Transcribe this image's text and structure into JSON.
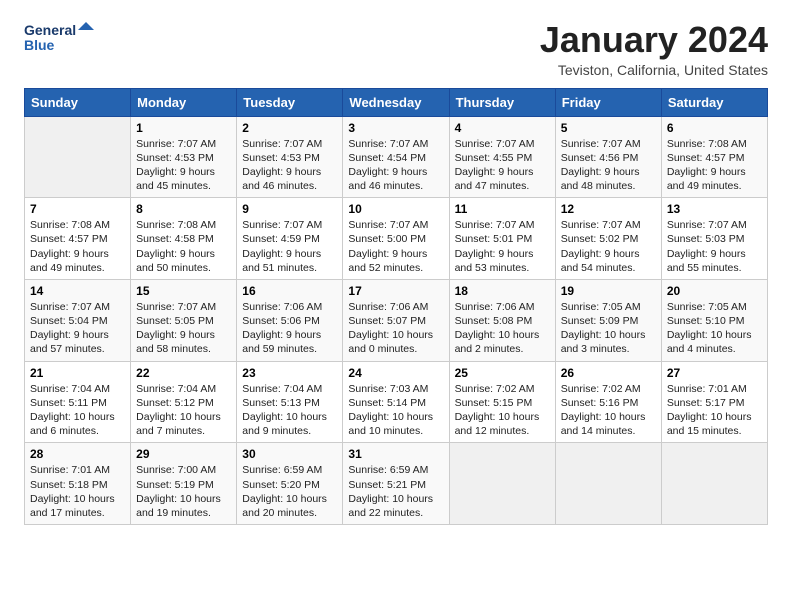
{
  "logo": {
    "line1": "General",
    "line2": "Blue"
  },
  "title": "January 2024",
  "location": "Teviston, California, United States",
  "days_of_week": [
    "Sunday",
    "Monday",
    "Tuesday",
    "Wednesday",
    "Thursday",
    "Friday",
    "Saturday"
  ],
  "weeks": [
    [
      {
        "num": "",
        "info": ""
      },
      {
        "num": "1",
        "info": "Sunrise: 7:07 AM\nSunset: 4:53 PM\nDaylight: 9 hours\nand 45 minutes."
      },
      {
        "num": "2",
        "info": "Sunrise: 7:07 AM\nSunset: 4:53 PM\nDaylight: 9 hours\nand 46 minutes."
      },
      {
        "num": "3",
        "info": "Sunrise: 7:07 AM\nSunset: 4:54 PM\nDaylight: 9 hours\nand 46 minutes."
      },
      {
        "num": "4",
        "info": "Sunrise: 7:07 AM\nSunset: 4:55 PM\nDaylight: 9 hours\nand 47 minutes."
      },
      {
        "num": "5",
        "info": "Sunrise: 7:07 AM\nSunset: 4:56 PM\nDaylight: 9 hours\nand 48 minutes."
      },
      {
        "num": "6",
        "info": "Sunrise: 7:08 AM\nSunset: 4:57 PM\nDaylight: 9 hours\nand 49 minutes."
      }
    ],
    [
      {
        "num": "7",
        "info": "Sunrise: 7:08 AM\nSunset: 4:57 PM\nDaylight: 9 hours\nand 49 minutes."
      },
      {
        "num": "8",
        "info": "Sunrise: 7:08 AM\nSunset: 4:58 PM\nDaylight: 9 hours\nand 50 minutes."
      },
      {
        "num": "9",
        "info": "Sunrise: 7:07 AM\nSunset: 4:59 PM\nDaylight: 9 hours\nand 51 minutes."
      },
      {
        "num": "10",
        "info": "Sunrise: 7:07 AM\nSunset: 5:00 PM\nDaylight: 9 hours\nand 52 minutes."
      },
      {
        "num": "11",
        "info": "Sunrise: 7:07 AM\nSunset: 5:01 PM\nDaylight: 9 hours\nand 53 minutes."
      },
      {
        "num": "12",
        "info": "Sunrise: 7:07 AM\nSunset: 5:02 PM\nDaylight: 9 hours\nand 54 minutes."
      },
      {
        "num": "13",
        "info": "Sunrise: 7:07 AM\nSunset: 5:03 PM\nDaylight: 9 hours\nand 55 minutes."
      }
    ],
    [
      {
        "num": "14",
        "info": "Sunrise: 7:07 AM\nSunset: 5:04 PM\nDaylight: 9 hours\nand 57 minutes."
      },
      {
        "num": "15",
        "info": "Sunrise: 7:07 AM\nSunset: 5:05 PM\nDaylight: 9 hours\nand 58 minutes."
      },
      {
        "num": "16",
        "info": "Sunrise: 7:06 AM\nSunset: 5:06 PM\nDaylight: 9 hours\nand 59 minutes."
      },
      {
        "num": "17",
        "info": "Sunrise: 7:06 AM\nSunset: 5:07 PM\nDaylight: 10 hours\nand 0 minutes."
      },
      {
        "num": "18",
        "info": "Sunrise: 7:06 AM\nSunset: 5:08 PM\nDaylight: 10 hours\nand 2 minutes."
      },
      {
        "num": "19",
        "info": "Sunrise: 7:05 AM\nSunset: 5:09 PM\nDaylight: 10 hours\nand 3 minutes."
      },
      {
        "num": "20",
        "info": "Sunrise: 7:05 AM\nSunset: 5:10 PM\nDaylight: 10 hours\nand 4 minutes."
      }
    ],
    [
      {
        "num": "21",
        "info": "Sunrise: 7:04 AM\nSunset: 5:11 PM\nDaylight: 10 hours\nand 6 minutes."
      },
      {
        "num": "22",
        "info": "Sunrise: 7:04 AM\nSunset: 5:12 PM\nDaylight: 10 hours\nand 7 minutes."
      },
      {
        "num": "23",
        "info": "Sunrise: 7:04 AM\nSunset: 5:13 PM\nDaylight: 10 hours\nand 9 minutes."
      },
      {
        "num": "24",
        "info": "Sunrise: 7:03 AM\nSunset: 5:14 PM\nDaylight: 10 hours\nand 10 minutes."
      },
      {
        "num": "25",
        "info": "Sunrise: 7:02 AM\nSunset: 5:15 PM\nDaylight: 10 hours\nand 12 minutes."
      },
      {
        "num": "26",
        "info": "Sunrise: 7:02 AM\nSunset: 5:16 PM\nDaylight: 10 hours\nand 14 minutes."
      },
      {
        "num": "27",
        "info": "Sunrise: 7:01 AM\nSunset: 5:17 PM\nDaylight: 10 hours\nand 15 minutes."
      }
    ],
    [
      {
        "num": "28",
        "info": "Sunrise: 7:01 AM\nSunset: 5:18 PM\nDaylight: 10 hours\nand 17 minutes."
      },
      {
        "num": "29",
        "info": "Sunrise: 7:00 AM\nSunset: 5:19 PM\nDaylight: 10 hours\nand 19 minutes."
      },
      {
        "num": "30",
        "info": "Sunrise: 6:59 AM\nSunset: 5:20 PM\nDaylight: 10 hours\nand 20 minutes."
      },
      {
        "num": "31",
        "info": "Sunrise: 6:59 AM\nSunset: 5:21 PM\nDaylight: 10 hours\nand 22 minutes."
      },
      {
        "num": "",
        "info": ""
      },
      {
        "num": "",
        "info": ""
      },
      {
        "num": "",
        "info": ""
      }
    ]
  ]
}
